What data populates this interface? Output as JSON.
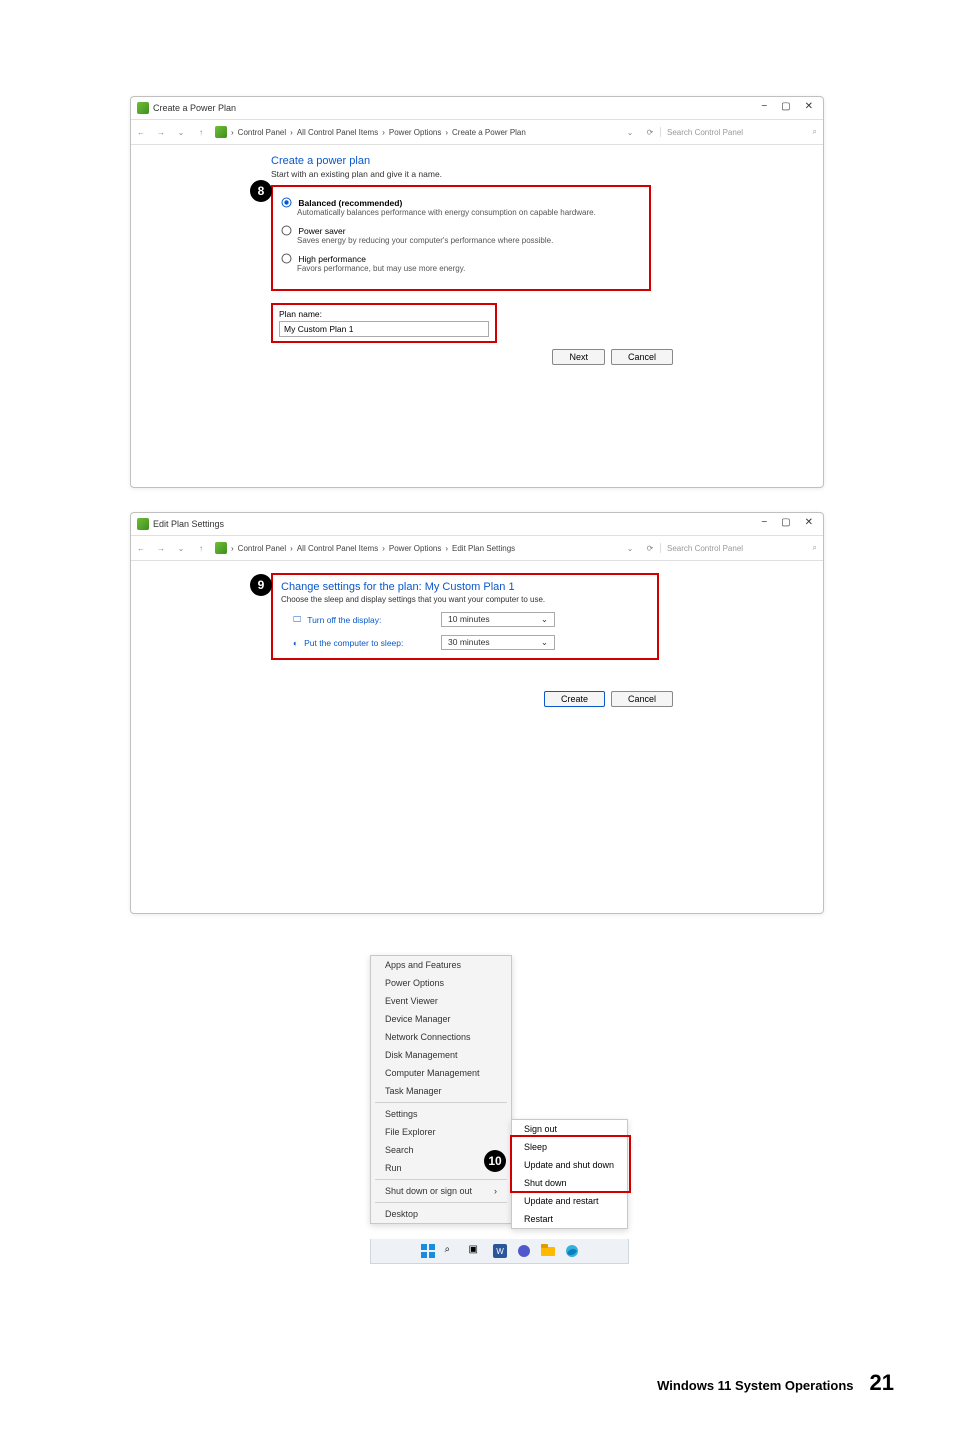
{
  "window1": {
    "title": "Create a Power Plan",
    "breadcrumb": [
      "Control Panel",
      "All Control Panel Items",
      "Power Options",
      "Create a Power Plan"
    ],
    "search_placeholder": "Search Control Panel",
    "heading": "Create a power plan",
    "subheading": "Start with an existing plan and give it a name.",
    "options": {
      "balanced_label": "Balanced (recommended)",
      "balanced_desc": "Automatically balances performance with energy consumption on capable hardware.",
      "saver_label": "Power saver",
      "saver_desc": "Saves energy by reducing your computer's performance where possible.",
      "high_label": "High performance",
      "high_desc": "Favors performance, but may use more energy."
    },
    "planname_label": "Plan name:",
    "planname_value": "My Custom Plan 1",
    "next_label": "Next",
    "cancel_label": "Cancel",
    "callout": "8"
  },
  "window2": {
    "title": "Edit Plan Settings",
    "breadcrumb": [
      "Control Panel",
      "All Control Panel Items",
      "Power Options",
      "Edit Plan Settings"
    ],
    "search_placeholder": "Search Control Panel",
    "heading": "Change settings for the plan: My Custom Plan 1",
    "subheading": "Choose the sleep and display settings that you want your computer to use.",
    "display_label": "Turn off the display:",
    "display_value": "10 minutes",
    "sleep_label": "Put the computer to sleep:",
    "sleep_value": "30 minutes",
    "create_label": "Create",
    "cancel_label": "Cancel",
    "callout": "9"
  },
  "ctxmenu": {
    "items": [
      "Apps and Features",
      "Power Options",
      "Event Viewer",
      "Device Manager",
      "Network Connections",
      "Disk Management",
      "Computer Management",
      "Task Manager",
      "Settings",
      "File Explorer",
      "Search",
      "Run"
    ],
    "shutdown_label": "Shut down or sign out",
    "desktop_label": "Desktop",
    "callout": "10"
  },
  "shutdown_sub": {
    "signout": "Sign out",
    "sleep": "Sleep",
    "update_shutdown": "Update and shut down",
    "shutdown": "Shut down",
    "update_restart": "Update and restart",
    "restart": "Restart"
  },
  "footer": {
    "text": "Windows 11 System Operations",
    "page": "21"
  }
}
